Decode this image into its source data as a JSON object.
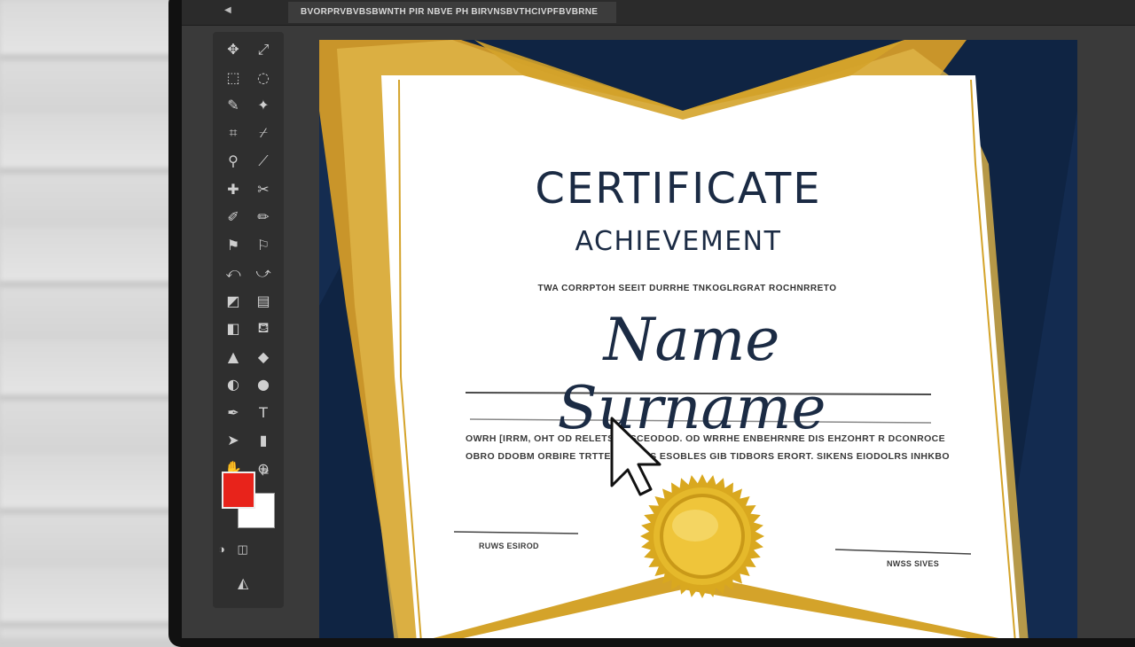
{
  "app": {
    "document_tab": "BVORPRVBVBSBWNTH PIR NBVE PH BIRVNSBVTHCIVPFBVBRNE"
  },
  "toolbar": {
    "tools": [
      {
        "icon": "move-icon",
        "glyph": "✥"
      },
      {
        "icon": "artboard-icon",
        "glyph": "⤢"
      },
      {
        "icon": "marquee-icon",
        "glyph": "⬚"
      },
      {
        "icon": "lasso-icon",
        "glyph": "◌"
      },
      {
        "icon": "quick-select-icon",
        "glyph": "✎"
      },
      {
        "icon": "magic-wand-icon",
        "glyph": "✦"
      },
      {
        "icon": "crop-icon",
        "glyph": "⌗"
      },
      {
        "icon": "slice-icon",
        "glyph": "⌿"
      },
      {
        "icon": "eyedropper-icon",
        "glyph": "⚲"
      },
      {
        "icon": "ruler-icon",
        "glyph": "⟋"
      },
      {
        "icon": "healing-brush-icon",
        "glyph": "✚"
      },
      {
        "icon": "patch-icon",
        "glyph": "✂"
      },
      {
        "icon": "brush-icon",
        "glyph": "✐"
      },
      {
        "icon": "pencil-icon",
        "glyph": "✏"
      },
      {
        "icon": "clone-stamp-icon",
        "glyph": "⚑"
      },
      {
        "icon": "pattern-stamp-icon",
        "glyph": "⚐"
      },
      {
        "icon": "history-brush-icon",
        "glyph": "⤺"
      },
      {
        "icon": "art-history-icon",
        "glyph": "⤻"
      },
      {
        "icon": "eraser-icon",
        "glyph": "◩"
      },
      {
        "icon": "bg-eraser-icon",
        "glyph": "▤"
      },
      {
        "icon": "gradient-icon",
        "glyph": "◧"
      },
      {
        "icon": "paint-bucket-icon",
        "glyph": "⛾"
      },
      {
        "icon": "blur-icon",
        "glyph": "▲"
      },
      {
        "icon": "sharpen-icon",
        "glyph": "◆"
      },
      {
        "icon": "dodge-icon",
        "glyph": "◐"
      },
      {
        "icon": "burn-icon",
        "glyph": "●"
      },
      {
        "icon": "pen-icon",
        "glyph": "✒"
      },
      {
        "icon": "text-icon",
        "glyph": "T"
      },
      {
        "icon": "path-select-icon",
        "glyph": "➤"
      },
      {
        "icon": "shape-icon",
        "glyph": "▮"
      },
      {
        "icon": "hand-icon",
        "glyph": "✋"
      },
      {
        "icon": "zoom-icon",
        "glyph": "⊕"
      }
    ],
    "foreground_color": "#e8231b",
    "background_color": "#ffffff"
  },
  "certificate": {
    "title": "CERTIFICATE",
    "subtitle": "ACHIEVEMENT",
    "presented_line": "TWA CORRPTOH SEEIT DURRHE TNKOGLRGRAT ROCHNRRETO",
    "recipient": "Name Surname",
    "body_line_1": "OWRH [IRRM, OHT OD RELETS TBSCEODOD. OD WRRHE ENBEHRNRE DIS EHZOHRT R DCONROCE",
    "body_line_2": "OBRO DDOBM ORBIRE TRTTECO DHOS ESOBLES GIB TIDBORS ERORT. SIKENS EIODOLRS INHKBO",
    "signature_left": "RUWS ESIROD",
    "signature_right": "NWSS SIVES"
  },
  "colors": {
    "navy": "#0f2443",
    "gold": "#d4a32a",
    "paper": "#ffffff"
  }
}
